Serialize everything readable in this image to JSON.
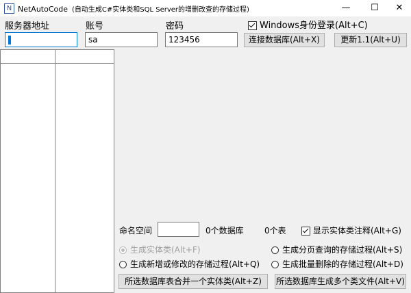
{
  "window": {
    "title": "NetAutoCode",
    "subtitle": "(自动生成C#实体类和SQL Server的增删改查的存储过程)",
    "minimize_glyph": "—",
    "maximize_glyph": "☐",
    "close_glyph": "✕",
    "icon": "N"
  },
  "connection": {
    "server_label": "服务器地址",
    "server_value": "",
    "account_label": "账号",
    "account_value": "sa",
    "password_label": "密码",
    "password_value": "123456",
    "windows_auth_label": "Windows身份登录(Alt+C)",
    "windows_auth_checked": true,
    "connect_button": "连接数据库(Alt+X)",
    "update_button": "更新1.1(Alt+U)"
  },
  "lists": {
    "databases": [],
    "tables": []
  },
  "options": {
    "namespace_label": "命名空间",
    "namespace_value": "",
    "db_count": "0个数据库",
    "table_count": "0个表",
    "show_comments_label": "显示实体类注释(Alt+G)",
    "show_comments_checked": true,
    "radio_entity": "生成实体类(Alt+F)",
    "radio_paging": "生成分页查询的存储过程(Alt+S)",
    "radio_insert_update": "生成新增或修改的存储过程(Alt+Q)",
    "radio_batch_delete": "生成批量删除的存储过程(Alt+D)",
    "merge_button": "所选数据库表合并一个实体类(Alt+Z)",
    "multi_button": "所选数据库生成多个类文件(Alt+V)"
  },
  "colors": {
    "accent": "#0078d7",
    "window_bg": "#f0f0f0",
    "button_bg": "#e1e1e1"
  }
}
